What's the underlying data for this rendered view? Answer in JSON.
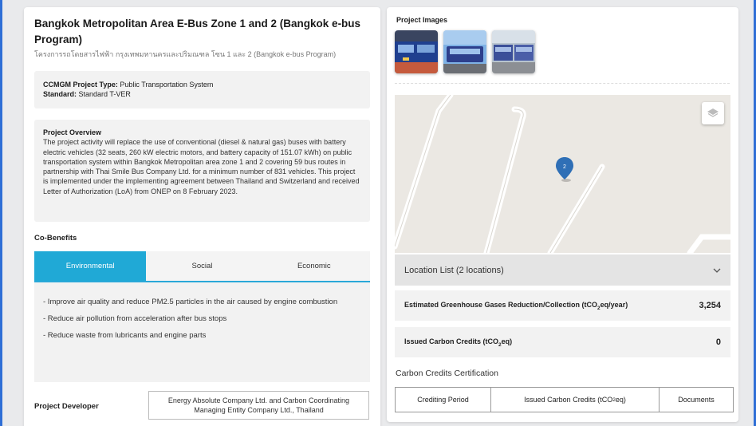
{
  "project": {
    "title": "Bangkok Metropolitan Area E-Bus Zone 1 and 2 (Bangkok e-bus Program)",
    "subtitle": "โครงการรถโดยสารไฟฟ้า กรุงเทพมหานครและปริมณฑล โซน 1 และ 2 (Bangkok e-bus Program)",
    "type_label": "CCMGM Project Type:",
    "type_value": "Public Transportation System",
    "standard_label": "Standard:",
    "standard_value": "Standard T-VER",
    "overview_label": "Project Overview",
    "overview_text": "The project activity will replace the use of conventional (diesel & natural gas) buses with battery electric vehicles (32 seats, 260 kW electric motors, and battery capacity of 151.07 kWh) on public transportation system within Bangkok Metropolitan area zone 1 and 2 covering 59 bus routes in partnership with Thai Smile Bus Company Ltd. for a minimum number of 831 vehicles. This project is implemented under the implementing agreement between Thailand and Switzerland and received Letter of Authorization (LoA) from ONEP on 8 February 2023."
  },
  "cobenefits": {
    "heading": "Co-Benefits",
    "tabs": [
      "Environmental",
      "Social",
      "Economic"
    ],
    "active_tab": 0,
    "items": [
      "- Improve air quality and reduce PM2.5 particles in the air caused by engine combustion",
      "- Reduce air pollution from acceleration after bus stops",
      "- Reduce waste from lubricants and engine parts"
    ]
  },
  "developer": {
    "label": "Project Developer",
    "value": "Energy Absolute Company Ltd. and Carbon Coordinating Managing Entity Company Ltd., Thailand"
  },
  "images": {
    "label": "Project Images",
    "thumbs": [
      "bus-photo-1",
      "bus-photo-2",
      "bus-photo-3"
    ]
  },
  "map": {
    "marker_label": "2",
    "layers_icon": "layers-icon"
  },
  "location_list": {
    "label": "Location List (2 locations)"
  },
  "stats": {
    "ghg_label_pre": "Estimated Greenhouse Gases Reduction/Collection (tCO",
    "ghg_label_sub": "2",
    "ghg_label_post": "eq/year)",
    "ghg_value": "3,254",
    "issued_label_pre": "Issued Carbon Credits (tCO",
    "issued_label_sub": "2",
    "issued_label_post": "eq)",
    "issued_value": "0"
  },
  "certification": {
    "title": "Carbon Credits Certification",
    "col_period": "Crediting Period",
    "col_issued_pre": "Issued Carbon Credits (tCO",
    "col_issued_sub": "2",
    "col_issued_post": "eq)",
    "col_documents": "Documents"
  },
  "colors": {
    "accent": "#20a9d6",
    "marker": "#2f6fb6",
    "frame": "#2f6fd6"
  }
}
